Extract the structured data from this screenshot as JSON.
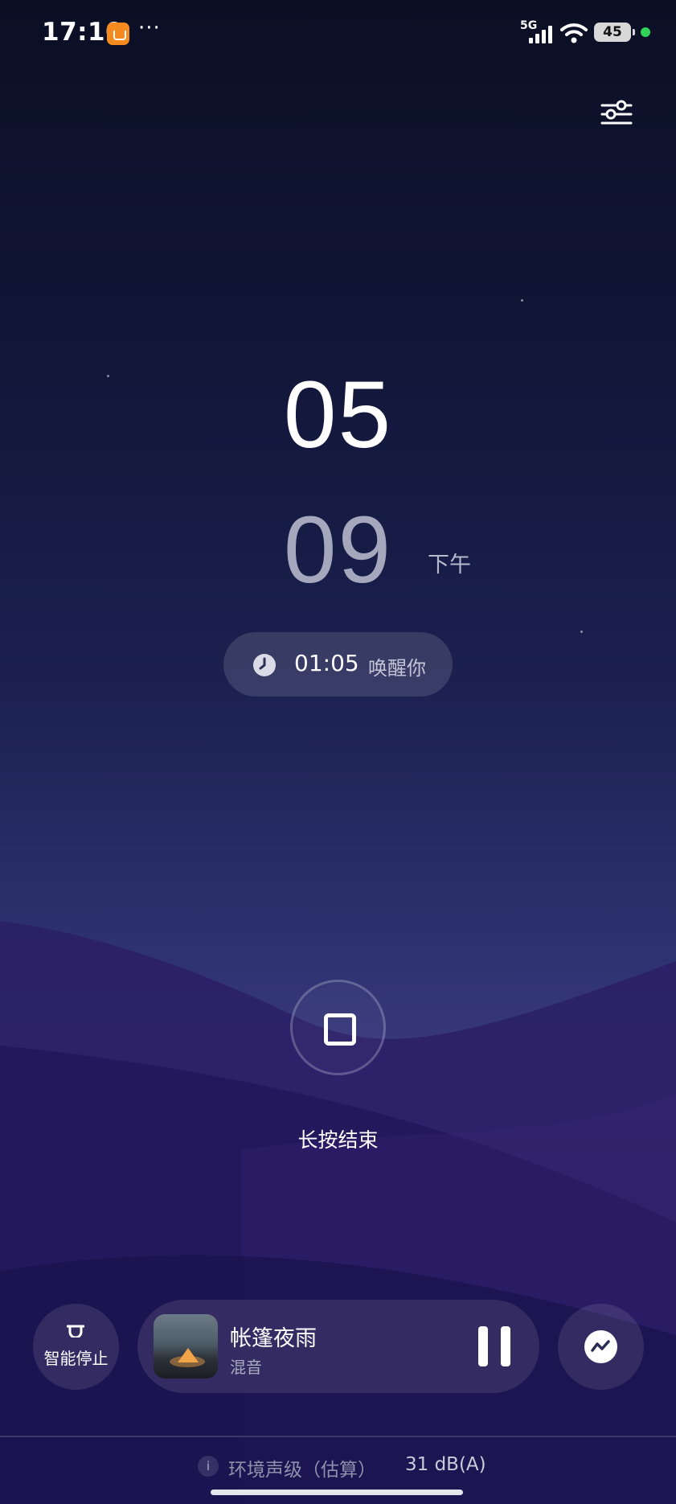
{
  "status_bar": {
    "time": "17:10",
    "more": "···",
    "network": "5G",
    "battery": "45",
    "icons": [
      "shopping-app-icon",
      "signal-icon",
      "wifi-icon",
      "battery-icon",
      "charging-dot-icon"
    ]
  },
  "header": {
    "settings_icon": "sliders-icon"
  },
  "clock": {
    "hour": "05",
    "minute": "09",
    "period": "下午"
  },
  "alarm": {
    "icon": "clock-icon",
    "time": "01:05",
    "label": "唤醒你"
  },
  "stop": {
    "icon": "stop-square-icon",
    "label": "长按结束"
  },
  "controls": {
    "smart_stop": {
      "icon": "smart-stop-icon",
      "label": "智能停止"
    },
    "player": {
      "title": "帐篷夜雨",
      "subtitle": "混音",
      "state_icon": "pause-icon"
    },
    "trend_icon": "trend-chart-icon"
  },
  "environment": {
    "info": "i",
    "label": "环境声级（估算）",
    "value": "31 dB(A)"
  },
  "colors": {
    "background_top": "#0b0f24",
    "hill_purple": "#2b1d5e",
    "charging_green": "#2fd35a",
    "app_orange": "#f58a1f"
  }
}
